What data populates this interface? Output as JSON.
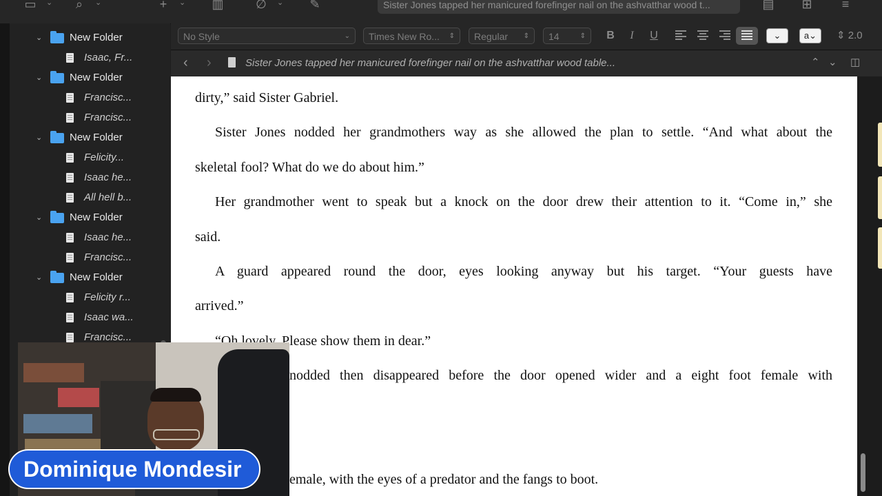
{
  "toolbar": {
    "document_title": "Sister Jones tapped her manicured forefinger nail on the ashvatthar wood t...",
    "icons": [
      "sidebar-icon",
      "search-icon",
      "add-icon",
      "trash-icon",
      "attach-icon",
      "compose-icon",
      "page-view-icon",
      "grid-view-icon",
      "menu-icon"
    ]
  },
  "binder": {
    "items": [
      {
        "type": "doc",
        "label": "Isaac, Fr..."
      },
      {
        "type": "folder",
        "label": "New Folder"
      },
      {
        "type": "doc",
        "label": "Francisc..."
      },
      {
        "type": "doc",
        "label": "Francisc..."
      },
      {
        "type": "folder",
        "label": "New Folder"
      },
      {
        "type": "doc",
        "label": "Felicity..."
      },
      {
        "type": "doc",
        "label": "Isaac he..."
      },
      {
        "type": "doc",
        "label": "All hell b..."
      },
      {
        "type": "folder",
        "label": "New Folder"
      },
      {
        "type": "doc",
        "label": "Isaac he..."
      },
      {
        "type": "doc",
        "label": "Francisc..."
      },
      {
        "type": "folder",
        "label": "New Folder"
      },
      {
        "type": "doc",
        "label": "Felicity r..."
      },
      {
        "type": "doc",
        "label": "Isaac wa..."
      },
      {
        "type": "doc",
        "label": "Francisc..."
      }
    ],
    "top_folder": "New Folder"
  },
  "format_bar": {
    "style": "No Style",
    "font_family": "Times New Ro...",
    "font_weight": "Regular",
    "font_size": "14",
    "bold": "B",
    "italic": "I",
    "underline": "U",
    "text_color_label": "a",
    "line_spacing": "2.0"
  },
  "header_bar": {
    "title": "Sister Jones tapped her manicured forefinger nail on the ashvatthar wood table..."
  },
  "editor": {
    "lines": [
      "dirty,” said Sister Gabriel.",
      "Sister Jones nodded her grandmothers way as she allowed the plan to settle. “And what about the",
      "skeletal fool? What do we do about him.”",
      "Her grandmother went to speak but a knock on the door drew their attention to it. “Come in,” she",
      "said.",
      "A guard appeared round the door, eyes looking anyway but his target. “Your guests have",
      "arrived.”",
      "“Oh lovely. Please show them in dear.”",
      "nodded then disappeared before the door opened wider and a eight foot female with",
      "emale, with the eyes of a predator and the fangs to boot."
    ]
  },
  "overlay": {
    "presenter_name": "Dominique Mondesir",
    "badge_color": "#1f5bd8"
  },
  "colors": {
    "folder": "#4aa3f0",
    "background": "#1e1e1e",
    "page": "#ffffff"
  }
}
